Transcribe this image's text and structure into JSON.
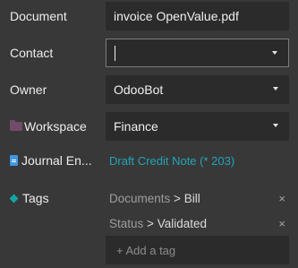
{
  "fields": {
    "document": {
      "label": "Document",
      "value": "invoice OpenValue.pdf"
    },
    "contact": {
      "label": "Contact",
      "value": ""
    },
    "owner": {
      "label": "Owner",
      "value": "OdooBot"
    },
    "workspace": {
      "label": "Workspace",
      "value": "Finance"
    },
    "journal_entry": {
      "label": "Journal En...",
      "value": "Draft Credit Note (* 203)"
    }
  },
  "tags": {
    "label": "Tags",
    "items": [
      {
        "category": "Documents",
        "separator": ">",
        "name": "Bill",
        "remove": "×"
      },
      {
        "category": "Status",
        "separator": ">",
        "name": "Validated",
        "remove": "×"
      }
    ],
    "add_placeholder": "+ Add a tag"
  },
  "colors": {
    "background": "#383838",
    "field_background": "#2b2b2b",
    "link": "#22a5b8",
    "workspace_icon": "#714b67",
    "document_icon": "#3f97e0",
    "tag_icon": "#14a6a0"
  },
  "icons": {
    "workspace": "folder-icon",
    "journal_entry": "document-icon",
    "tags": "tag-icon",
    "dropdown": "caret-down-icon"
  }
}
